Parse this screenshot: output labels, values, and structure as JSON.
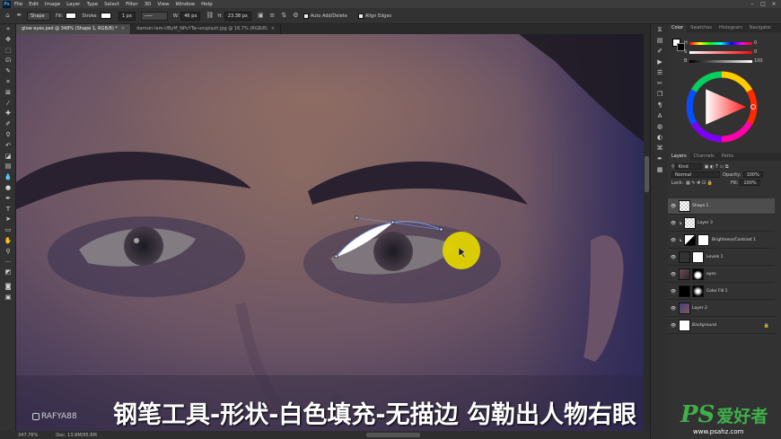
{
  "app": {
    "logo": "Ps"
  },
  "menu": [
    "File",
    "Edit",
    "Image",
    "Layer",
    "Type",
    "Select",
    "Filter",
    "3D",
    "View",
    "Window",
    "Help"
  ],
  "window_controls": [
    "–",
    "□",
    "×"
  ],
  "options": {
    "mode": "Shape",
    "fill_label": "Fill:",
    "stroke_label": "Stroke:",
    "stroke_width": "1 px",
    "w_label": "W:",
    "w_value": "46 px",
    "h_label": "H:",
    "h_value": "23.38 px",
    "auto_add_delete": "Auto Add/Delete",
    "align_edges": "Align Edges"
  },
  "doc_tabs": [
    {
      "label": "glow eyes.psd @ 348% (Shape 1, RGB/8) *",
      "active": true
    },
    {
      "label": "damsin-lam-UByM_NPvYTw-unsplash.jpg @ 16.7% (RGB/8)",
      "active": false
    }
  ],
  "status": {
    "zoom": "347.76%",
    "doc": "Doc: 13.8M/95.8M"
  },
  "color_panel": {
    "tabs": [
      "Color",
      "Swatches",
      "Histogram",
      "Navigator"
    ],
    "h_label": "H",
    "h_value": "0",
    "s_label": "S",
    "s_value": "0",
    "b_label": "B",
    "b_value": "100",
    "fg_color": "#ffffff",
    "bg_color": "#000000"
  },
  "layers_panel": {
    "tabs": [
      "Layers",
      "Channels",
      "Paths"
    ],
    "filter": "Kind",
    "blend_mode": "Normal",
    "opacity_label": "Opacity:",
    "opacity": "100%",
    "lock_label": "Lock:",
    "fill_label": "Fill:",
    "fill": "100%",
    "layers": [
      {
        "name": "Shape 1",
        "selected": true,
        "thumb": "checker"
      },
      {
        "name": "Layer 3",
        "selected": false,
        "thumb": "checker"
      },
      {
        "name": "Brightness/Contrast 1",
        "selected": false,
        "thumb": "adjust"
      },
      {
        "name": "Levels 1",
        "selected": false,
        "thumb": "levels"
      },
      {
        "name": "eyes",
        "selected": false,
        "thumb": "photo"
      },
      {
        "name": "Color Fill 1",
        "selected": false,
        "thumb": "black"
      },
      {
        "name": "Layer 2",
        "selected": false,
        "thumb": "photo2"
      },
      {
        "name": "Background",
        "selected": false,
        "thumb": "white"
      }
    ]
  },
  "caption": "钢笔工具-形状-白色填充-无描边 勾勒出人物右眼",
  "watermark": "RAFYA88",
  "site_logo": {
    "ps": "PS",
    "cn": "爱好者",
    "url": "www.psahz.com"
  }
}
